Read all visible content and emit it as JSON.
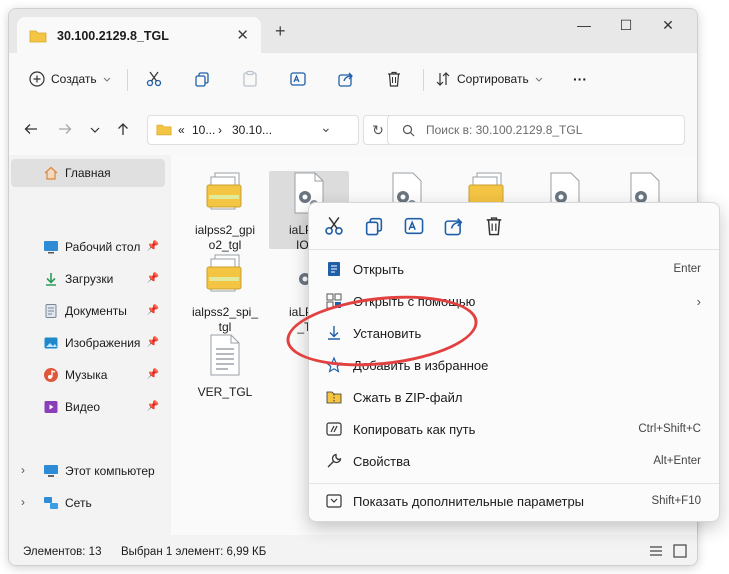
{
  "window": {
    "tab_title": "30.100.2129.8_TGL",
    "close_tab": "✕",
    "new_tab": "+",
    "controls": {
      "minimize": "—",
      "maximize": "☐",
      "close": "✕"
    }
  },
  "toolbar": {
    "create_label": "Создать",
    "sort_label": "Сортировать",
    "more_label": "···"
  },
  "address": {
    "crumb_prefix": "«",
    "crumb_1": "10...",
    "crumb_sep": "›",
    "crumb_2": "30.10...",
    "dropdown": "⌄",
    "refresh": "↻"
  },
  "search": {
    "placeholder": "Поиск в: 30.100.2129.8_TGL"
  },
  "sidebar": {
    "home": "Главная",
    "quick": [
      {
        "label": "Рабочий стол",
        "icon": "desktop-icon",
        "color": "#2e8bd6"
      },
      {
        "label": "Загрузки",
        "icon": "download-icon",
        "color": "#2a9d5a"
      },
      {
        "label": "Документы",
        "icon": "documents-icon",
        "color": "#7a8794"
      },
      {
        "label": "Изображения",
        "icon": "images-icon",
        "color": "#1e88c8"
      },
      {
        "label": "Музыка",
        "icon": "music-icon",
        "color": "#e2573a"
      },
      {
        "label": "Видео",
        "icon": "video-icon",
        "color": "#8a3fb8"
      }
    ],
    "this_pc": "Этот компьютер",
    "network": "Сеть"
  },
  "files": [
    {
      "label": "ialpss2_gpio2_tgl",
      "line1": "ialpss2_gpi",
      "line2": "o2_tgl",
      "type": "inf"
    },
    {
      "label": "iaLPSS2_GPIO2_TGL",
      "line1": "iaLPSS",
      "line2": "IO2_",
      "type": "sys"
    },
    {
      "label": "ialpss2_spi_tgl",
      "line1": "ialpss2_spi_",
      "line2": "tgl",
      "type": "inf"
    },
    {
      "label": "iaLPSS2_SPI_TGL",
      "line1": "iaLPSS",
      "line2": "_TG",
      "type": "sys"
    },
    {
      "label": "VER_TGL",
      "line1": "VER_TGL",
      "line2": "",
      "type": "txt"
    }
  ],
  "status": {
    "count": "Элементов: 13",
    "selected": "Выбран 1 элемент: 6,99 КБ"
  },
  "context_menu": {
    "items": [
      {
        "label": "Открыть",
        "shortcut": "Enter",
        "icon": "open-icon"
      },
      {
        "label": "Открыть с помощью",
        "shortcut": "",
        "icon": "open-with-icon",
        "arrow": "›"
      },
      {
        "label": "Установить",
        "shortcut": "",
        "icon": "install-icon"
      },
      {
        "label": "Добавить в избранное",
        "shortcut": "",
        "icon": "star-icon"
      },
      {
        "label": "Сжать в ZIP-файл",
        "shortcut": "",
        "icon": "zip-icon"
      },
      {
        "label": "Копировать как путь",
        "shortcut": "Ctrl+Shift+C",
        "icon": "copy-path-icon"
      },
      {
        "label": "Свойства",
        "shortcut": "Alt+Enter",
        "icon": "wrench-icon"
      },
      {
        "label": "Показать дополнительные параметры",
        "shortcut": "Shift+F10",
        "icon": "more-options-icon"
      }
    ]
  },
  "colors": {
    "accent": "#0067c0",
    "highlight": "#e34040",
    "folder": "#f4c443"
  }
}
